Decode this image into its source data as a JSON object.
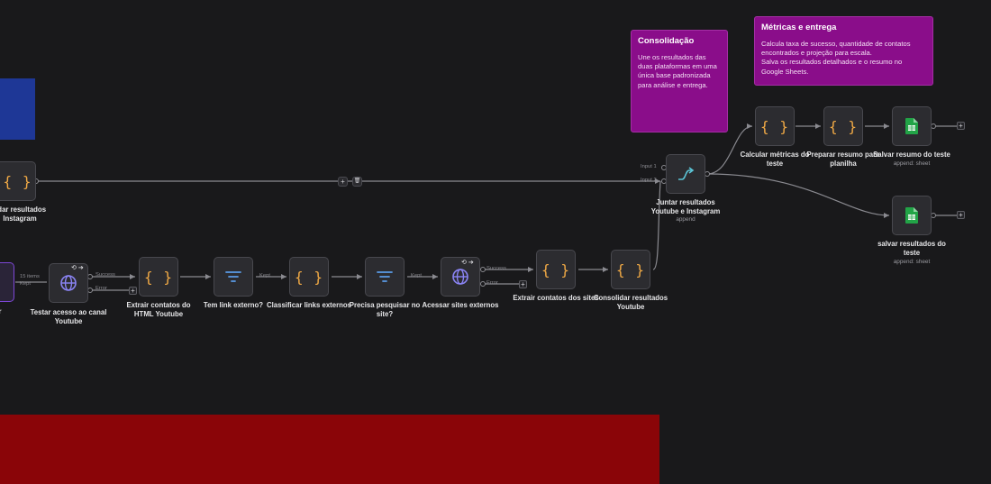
{
  "notes": {
    "consolidacao": {
      "title": "Consolidação",
      "text": "Une os resultados das\nduas plataformas em uma\núnica base padronizada\npara análise e entrega."
    },
    "metricas": {
      "title": "Métricas e entrega",
      "text": "Calcula taxa de sucesso, quantidade de contatos\nencontrados e projeção para escala.\nSalva os resultados detalhados e o resumo no\nGoogle Sheets."
    }
  },
  "nodes": {
    "consolidar_instagram": {
      "label": "lidar resultados\nInstagram"
    },
    "left_cut": {
      "label": "r"
    },
    "testar_acesso": {
      "label": "Testar acesso ao canal\nYoutube"
    },
    "extrair_html": {
      "label": "Extrair contatos do\nHTML Youtube"
    },
    "tem_link": {
      "label": "Tem link externo?"
    },
    "classificar_links": {
      "label": "Classificar links externos"
    },
    "precisa_pesquisar": {
      "label": "Precisa pesquisar no\nsite?"
    },
    "acessar_sites": {
      "label": "Acessar sites externos"
    },
    "extrair_sites": {
      "label": "Extrair contatos dos sites"
    },
    "consolidar_youtube": {
      "label": "Consolidar resultados\nYoutube"
    },
    "juntar": {
      "label": "Juntar resultados\nYoutube e Instagram",
      "sub": "append"
    },
    "calcular": {
      "label": "Calcular métricas do\nteste"
    },
    "preparar": {
      "label": "Preparar resumo para\nplanilha"
    },
    "salvar_resumo": {
      "label": "Salvar resumo do teste",
      "sub": "append: sheet"
    },
    "salvar_resultados": {
      "label": "salvar resultados do\nteste",
      "sub": "append: sheet"
    }
  },
  "ports": {
    "success": "Success",
    "error": "Error",
    "kept": "Kept",
    "input1": "Input 1",
    "input2": "Input 2",
    "items": "15 items"
  },
  "icons": {
    "code": "{ }",
    "plus": "+",
    "trash": "🗑",
    "refresh": "⟲",
    "arrow": "➔"
  },
  "colors": {
    "background": "#19191b",
    "note_purple": "#8a0d8a",
    "code_orange": "#f0a945",
    "filter_blue": "#5a9be6",
    "http_purple": "#8b84f5",
    "merge_teal": "#5bc4d6",
    "sheets_green": "#22a447"
  }
}
